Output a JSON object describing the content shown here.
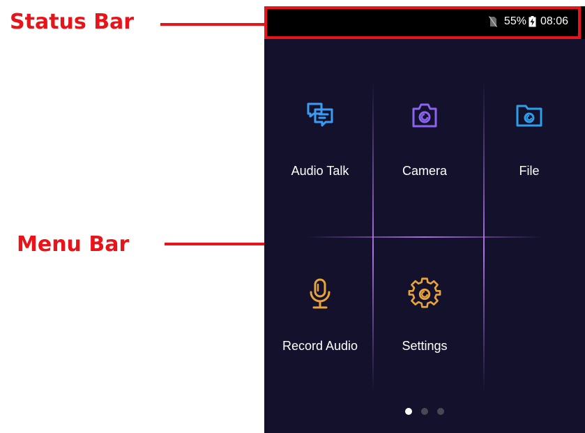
{
  "annotations": {
    "status_bar_label": "Status Bar",
    "menu_bar_label": "Menu Bar",
    "color": "#e8141a"
  },
  "status_bar": {
    "sim_icon": "no-sim-icon",
    "battery_percent": "55%",
    "battery_icon": "battery-icon",
    "time": "08:06"
  },
  "menu": {
    "items": [
      {
        "label": "Audio Talk",
        "icon": "chat-bubbles-icon",
        "color": "#3a9df4"
      },
      {
        "label": "Camera",
        "icon": "camera-icon",
        "color": "#8a63f0"
      },
      {
        "label": "File",
        "icon": "folder-icon",
        "color": "#2f9ee8"
      },
      {
        "label": "Record Audio",
        "icon": "microphone-icon",
        "color": "#e8a43c"
      },
      {
        "label": "Settings",
        "icon": "gear-icon",
        "color": "#e8a43c"
      }
    ]
  },
  "pagination": {
    "total_pages": 3,
    "current_page": 1
  },
  "theme": {
    "screen_background": "#14112d",
    "status_bar_background": "#000000",
    "grid_line_color": "#b978f0"
  }
}
